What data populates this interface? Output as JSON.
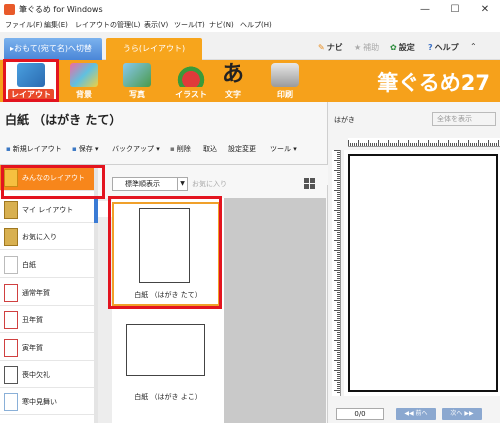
{
  "window": {
    "title": "筆ぐるめ for Windows",
    "minimize": "—",
    "maximize": "☐",
    "close": "✕"
  },
  "menu": [
    "ファイル(F)",
    "編集(E)",
    "レイアウトの管理(L)",
    "表示(V)",
    "ツール(T)",
    "ナビ(N)",
    "ヘルプ(H)"
  ],
  "tabs": {
    "omote": "▸おもて(宛て名)へ切替",
    "ura": "うら(レイアウト)"
  },
  "right_links": {
    "navi": "ナビ",
    "hojo": "補助",
    "settei": "設定",
    "help": "ヘルプ"
  },
  "ribbon": {
    "buttons": [
      "レイアウト",
      "背景",
      "写真",
      "イラスト",
      "文字",
      "印刷"
    ],
    "selected": "レイアウト",
    "brand": "筆ぐるめ27",
    "colors": {
      "ribbon": "#f6a11b",
      "highlight": "#e3141f"
    }
  },
  "panel": {
    "title": "白紙 （はがき たて）",
    "actions": [
      "新規レイアウト",
      "保存 ▾",
      "バックアップ ▾",
      "削除",
      "取込",
      "設定変更",
      "ツール ▾"
    ]
  },
  "categories": [
    "みんなのレイアウト",
    "マイ レイアウト",
    "お気に入り",
    "白紙",
    "通常年賀",
    "丑年賀",
    "寅年賀",
    "喪中欠礼",
    "寒中見舞い"
  ],
  "sort": {
    "value": "標準順表示",
    "favorite": "お気に入り"
  },
  "thumbnails": [
    {
      "caption": "白紙 （はがき たて）",
      "selected": true
    },
    {
      "caption": "白紙 （はがき よこ）",
      "selected": false
    }
  ],
  "preview": {
    "label": "はがき",
    "display_mode": "全体を表示",
    "page": "0/0",
    "prev": "◀◀ 前へ",
    "next": "次へ ▶▶"
  }
}
